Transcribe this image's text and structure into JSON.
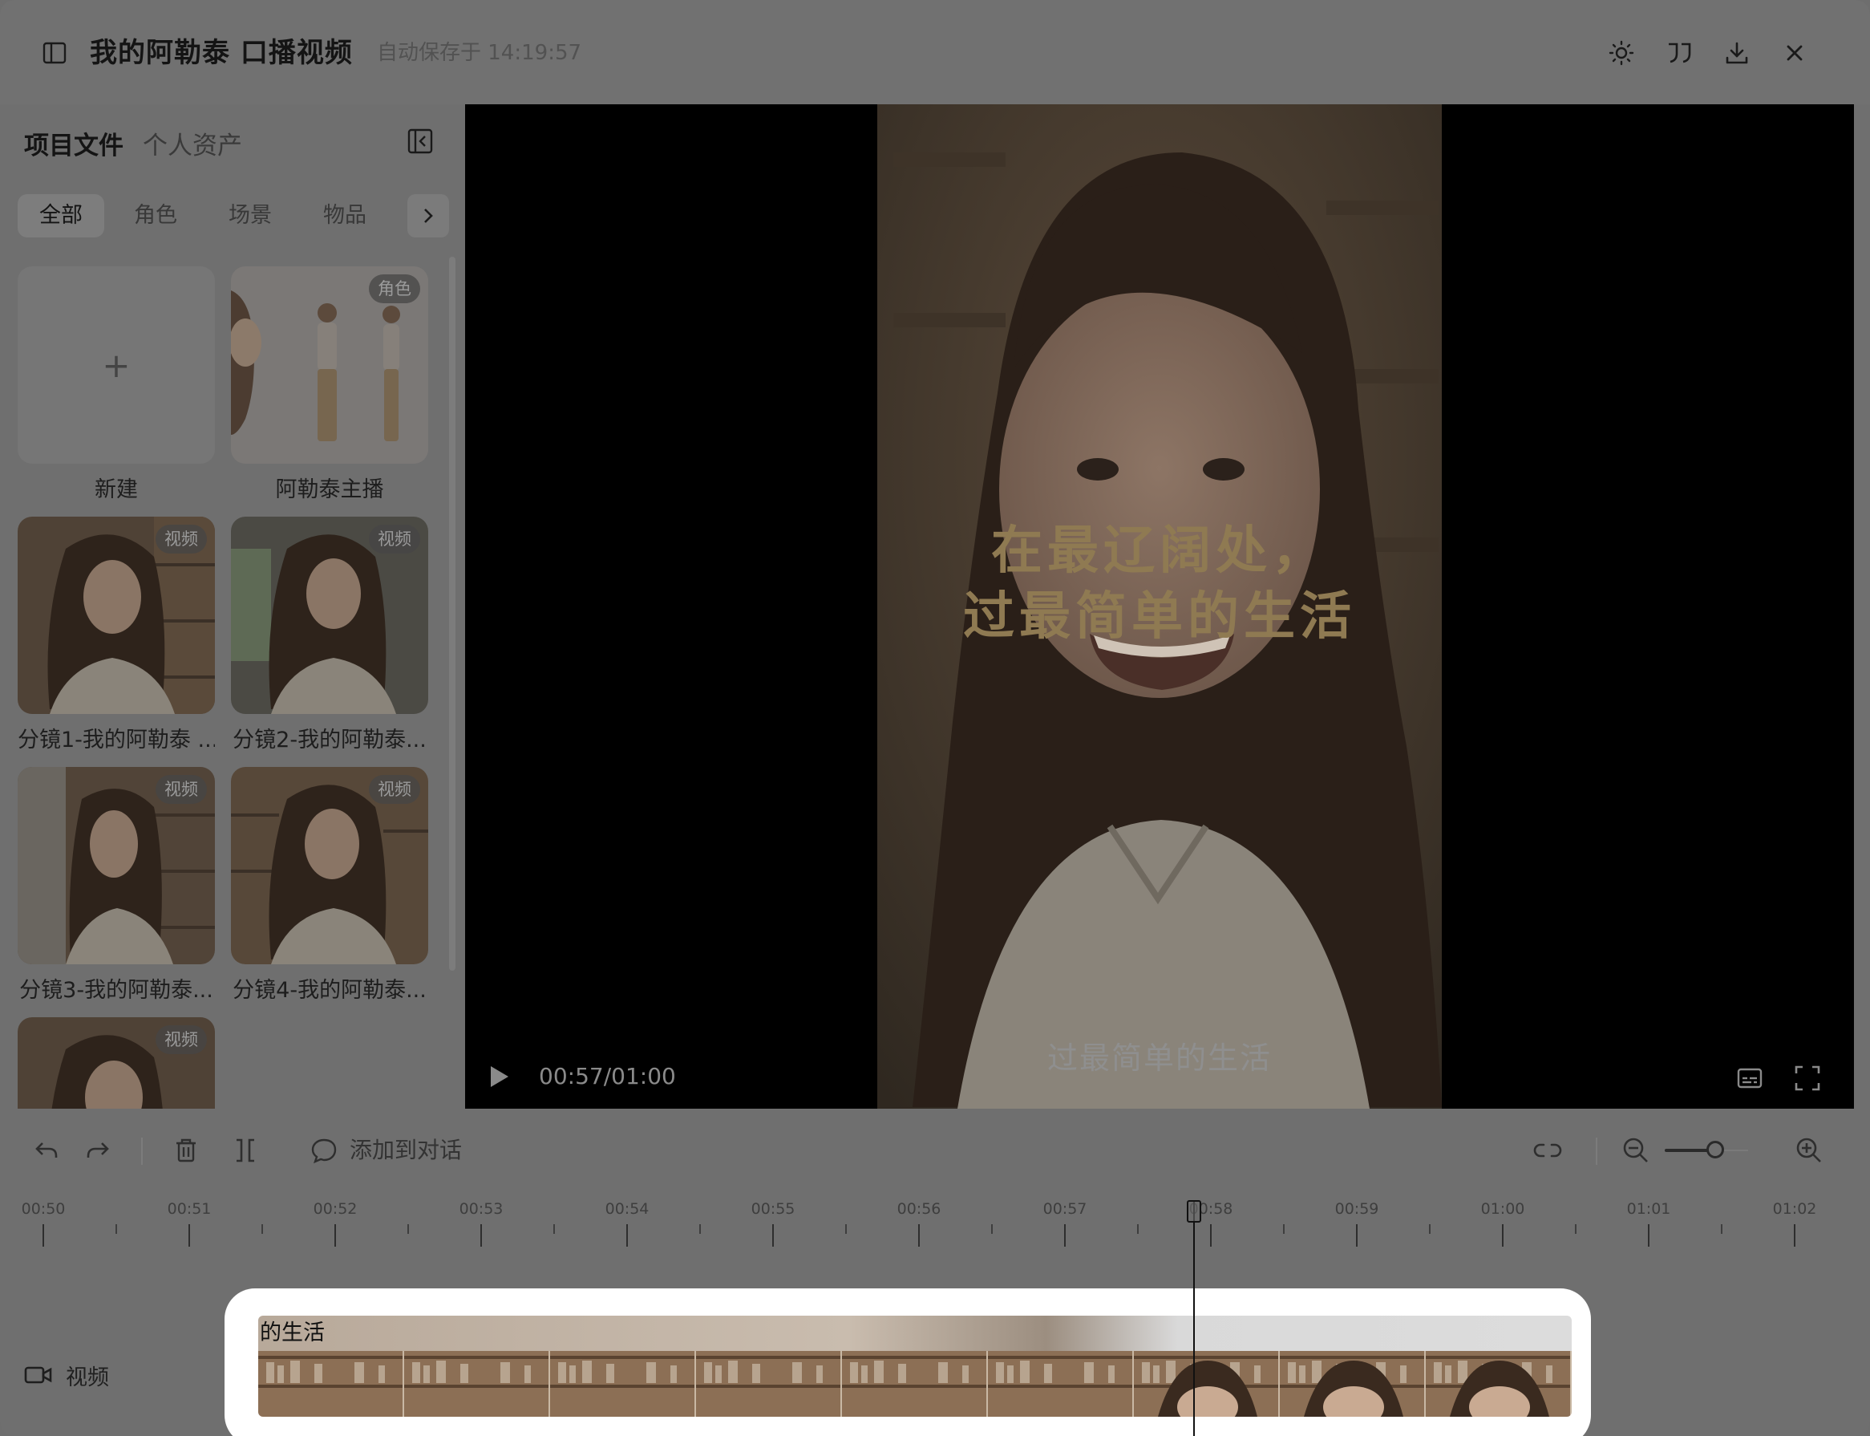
{
  "header": {
    "title": "我的阿勒泰 口播视频",
    "autosave": "自动保存于 14:19:57",
    "icons": [
      "sidebar-toggle-icon",
      "sun-icon",
      "quote-icon",
      "download-icon",
      "close-icon"
    ]
  },
  "sidebar": {
    "tabs": [
      "项目文件",
      "个人资产"
    ],
    "filters": [
      "全部",
      "角色",
      "场景",
      "物品"
    ],
    "active_filter": "全部",
    "cards": [
      {
        "label": "新建",
        "badge": "",
        "plus": "+"
      },
      {
        "label": "阿勒泰主播",
        "badge": "角色"
      },
      {
        "label": "分镜1-我的阿勒泰 ...",
        "badge": "视频"
      },
      {
        "label": "分镜2-我的阿勒泰...",
        "badge": "视频"
      },
      {
        "label": "分镜3-我的阿勒泰...",
        "badge": "视频"
      },
      {
        "label": "分镜4-我的阿勒泰...",
        "badge": "视频"
      },
      {
        "label": "",
        "badge": "视频"
      }
    ]
  },
  "preview": {
    "overlay_line1": "在最辽阔处，",
    "overlay_line2": "过最简单的生活",
    "caption": "过最简单的生活",
    "timecode": "00:57/01:00"
  },
  "toolbar": {
    "add_to_dialog": "添加到对话",
    "zoom_level": 0.75
  },
  "timeline": {
    "ticks": [
      "00:50",
      "00:51",
      "00:52",
      "00:53",
      "00:54",
      "00:55",
      "00:56",
      "00:57",
      "00:58",
      "00:59",
      "01:00",
      "01:01",
      "01:02"
    ],
    "playhead_time": "00:57.9",
    "track_label": "视频",
    "clip_title": "的生活",
    "accent": "#ffffff"
  }
}
